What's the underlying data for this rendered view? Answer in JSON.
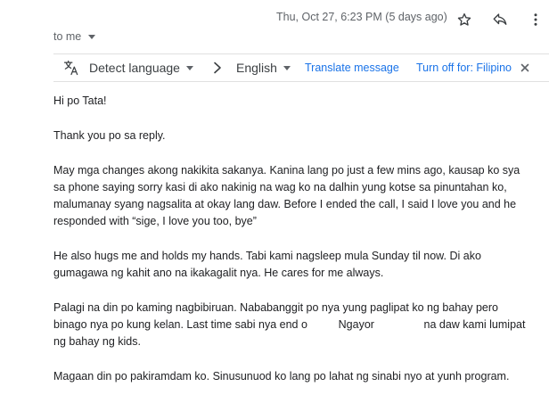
{
  "header": {
    "date": "Thu, Oct 27, 6:23 PM (5 days ago)",
    "recipient_label": "to me"
  },
  "icons": {
    "star": "star-icon",
    "reply": "reply-icon",
    "more": "more-vert-icon",
    "translate": "translate-icon",
    "arrow": "chevron-right-icon",
    "close": "close-icon"
  },
  "translate_bar": {
    "source_language": "Detect language",
    "target_language": "English",
    "translate_link": "Translate message",
    "turn_off_link": "Turn off for: Filipino"
  },
  "message": {
    "paragraphs": [
      {
        "lines": [
          "Hi po Tata!"
        ]
      },
      {
        "lines": [
          "Thank you po sa reply."
        ]
      },
      {
        "lines": [
          "May mga changes akong nakikita sakanya. Kanina lang po just a few mins ago, kausap ko sya",
          "sa phone saying sorry kasi di ako nakinig na wag ko na dalhin yung kotse sa pinuntahan ko,",
          "malumanay syang nagsalita at okay lang daw. Before I ended the call, I said I love you and he",
          "responded with “sige,  I love you too, bye”"
        ]
      },
      {
        "lines": [
          "He also hugs me and holds my hands. Tabi kami nagsleep mula Sunday til now. Di ako",
          "gumagawa ng kahit ano na ikakagalit nya. He cares for me always."
        ]
      },
      {
        "lines": [
          "Palagi na din po kaming nagbibiruan. Nababanggit po nya yung paglipat ko ng bahay pero",
          "binago nya po kung kelan. Last time sabi nya end o          Ngayor                na daw kami lumipat",
          "ng bahay ng kids."
        ]
      },
      {
        "lines": [
          "Magaan din po pakiramdam ko. Sinusunuod ko lang po lahat ng sinabi nyo at yunh program."
        ]
      }
    ]
  }
}
